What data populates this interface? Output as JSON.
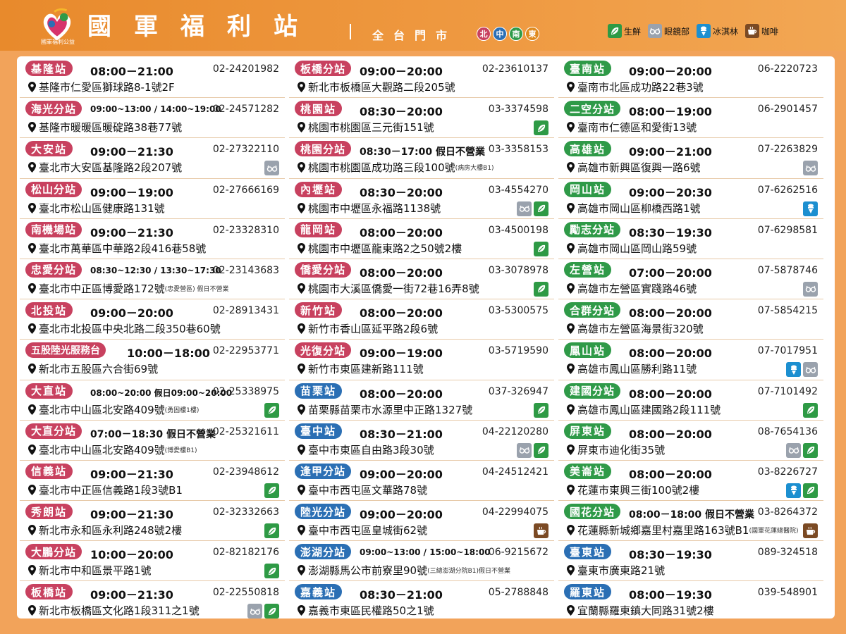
{
  "header": {
    "logo_text": "國軍福利公益",
    "title": "國軍福利站",
    "subtitle": "全台門市",
    "regions": [
      {
        "label": "北",
        "color": "#c8415f"
      },
      {
        "label": "中",
        "color": "#2b6fb4"
      },
      {
        "label": "南",
        "color": "#2f9a48"
      },
      {
        "label": "東",
        "color": "#e08a1e"
      }
    ],
    "legend": [
      {
        "icon": "fresh-produce-icon",
        "label": "生鮮"
      },
      {
        "icon": "glasses-icon",
        "label": "眼鏡部"
      },
      {
        "icon": "ice-cream-icon",
        "label": "冰淇林"
      },
      {
        "icon": "coffee-icon",
        "label": "咖啡"
      }
    ]
  },
  "columns": [
    [
      {
        "name": "基隆站",
        "hours": "08:00－21:00",
        "phone": "02-24201982",
        "address": "基隆市仁愛區獅球路8-1號2F",
        "note": "",
        "icons": []
      },
      {
        "name": "海光分站",
        "hours": "09:00~13:00 / 14:00~19:00",
        "phone": "02-24571282",
        "address": "基隆市暖暖區暖碇路38巷77號",
        "note": "",
        "icons": []
      },
      {
        "name": "大安站",
        "hours": "09:00－21:30",
        "phone": "02-27322110",
        "address": "臺北市大安區基隆路2段207號",
        "note": "",
        "icons": [
          "glasses"
        ]
      },
      {
        "name": "松山分站",
        "hours": "09:00－19:00",
        "phone": "02-27666169",
        "address": "臺北市松山區健康路131號",
        "note": "",
        "icons": []
      },
      {
        "name": "南機場站",
        "hours": "09:00－21:30",
        "phone": "02-23328310",
        "address": "臺北市萬華區中華路2段416巷58號",
        "note": "",
        "icons": []
      },
      {
        "name": "忠愛分站",
        "hours": "08:30~12:30 / 13:30~17:30",
        "phone": "02-23143683",
        "address": "臺北市中正區博愛路172號",
        "note": "(忠愛營區) 假日不營業",
        "icons": []
      },
      {
        "name": "北投站",
        "hours": "09:00－20:00",
        "phone": "02-28913431",
        "address": "臺北市北投區中央北路二段350巷60號",
        "note": "",
        "icons": []
      },
      {
        "name": "五股陸光服務台",
        "hours": "10:00－18:00",
        "phone": "02-22953771",
        "address": "新北市五股區六合街69號",
        "note": "",
        "icons": []
      },
      {
        "name": "大直站",
        "hours": "08:00~20:00 假日09:00~20:00",
        "phone": "02-25338975",
        "address": "臺北市中山區北安路409號",
        "note": "(勇固樓1樓)",
        "icons": [
          "fresh"
        ]
      },
      {
        "name": "大直分站",
        "hours": "07:00－18:30 假日不營業",
        "phone": "02-25321611",
        "address": "臺北市中山區北安路409號",
        "note": "(博愛樓B1)",
        "icons": []
      },
      {
        "name": "信義站",
        "hours": "09:00－21:30",
        "phone": "02-23948612",
        "address": "臺北市中正區信義路1段3號B1",
        "note": "",
        "icons": [
          "fresh"
        ]
      },
      {
        "name": "秀朗站",
        "hours": "09:00－21:30",
        "phone": "02-32332663",
        "address": "新北市永和區永利路248號2樓",
        "note": "",
        "icons": [
          "fresh"
        ]
      },
      {
        "name": "大鵬分站",
        "hours": "10:00－20:00",
        "phone": "02-82182176",
        "address": "新北市中和區景平路1號",
        "note": "",
        "icons": [
          "fresh"
        ]
      },
      {
        "name": "板橋站",
        "hours": "09:00－21:30",
        "phone": "02-22550818",
        "address": "新北市板橋區文化路1段311之1號",
        "note": "",
        "icons": [
          "glasses",
          "fresh"
        ]
      }
    ],
    [
      {
        "name": "板橋分站",
        "hours": "09:00－20:00",
        "phone": "02-23610137",
        "address": "新北市板橋區大觀路二段205號",
        "note": "",
        "icons": []
      },
      {
        "name": "桃園站",
        "hours": "08:30－20:00",
        "phone": "03-3374598",
        "address": "桃園市桃園區三元街151號",
        "note": "",
        "icons": [
          "fresh"
        ]
      },
      {
        "name": "桃園分站",
        "hours": "08:30－17:00 假日不營業",
        "phone": "03-3358153",
        "address": "桃園市桃園區成功路三段100號",
        "note": "(病房大樓B1)",
        "icons": []
      },
      {
        "name": "內壢站",
        "hours": "08:30－20:00",
        "phone": "03-4554270",
        "address": "桃園市中壢區永福路1138號",
        "note": "",
        "icons": [
          "glasses",
          "fresh"
        ]
      },
      {
        "name": "龍岡站",
        "hours": "08:00－20:00",
        "phone": "03-4500198",
        "address": "桃園市中壢區龍東路2之50號2樓",
        "note": "",
        "icons": [
          "fresh"
        ]
      },
      {
        "name": "僑愛分站",
        "hours": "08:00－20:00",
        "phone": "03-3078978",
        "address": "桃園市大溪區僑愛一街72巷16弄8號",
        "note": "",
        "icons": [
          "fresh"
        ]
      },
      {
        "name": "新竹站",
        "hours": "08:00－20:00",
        "phone": "03-5300575",
        "address": "新竹市香山區延平路2段6號",
        "note": "",
        "icons": []
      },
      {
        "name": "光復分站",
        "hours": "09:00－19:00",
        "phone": "03-5719590",
        "address": "新竹市東區建新路111號",
        "note": "",
        "icons": []
      },
      {
        "name": "苗栗站",
        "hours": "08:00－20:00",
        "phone": "037-326947",
        "address": "苗栗縣苗栗市水源里中正路1327號",
        "note": "",
        "icons": [
          "fresh"
        ]
      },
      {
        "name": "臺中站",
        "hours": "08:30－21:00",
        "phone": "04-22120280",
        "address": "臺中市東區自由路3段30號",
        "note": "",
        "icons": [
          "glasses",
          "fresh"
        ]
      },
      {
        "name": "逢甲分站",
        "hours": "09:00－20:00",
        "phone": "04-24512421",
        "address": "臺中市西屯區文華路78號",
        "note": "",
        "icons": []
      },
      {
        "name": "陸光分站",
        "hours": "09:00－20:00",
        "phone": "04-22994075",
        "address": "臺中市西屯區皇城街62號",
        "note": "",
        "icons": [
          "coffee"
        ]
      },
      {
        "name": "澎湖分站",
        "hours": "09:00~13:00 / 15:00~18:00",
        "phone": "06-9215672",
        "address": "澎湖縣馬公市前寮里90號",
        "note": "(三總澎湖分院B1)假日不營業",
        "icons": []
      },
      {
        "name": "嘉義站",
        "hours": "08:30－21:00",
        "phone": "05-2788848",
        "address": "嘉義市東區民權路50之1號",
        "note": "",
        "icons": []
      }
    ],
    [
      {
        "name": "臺南站",
        "hours": "09:00－20:00",
        "phone": "06-2220723",
        "address": "臺南市北區成功路22巷3號",
        "note": "",
        "icons": []
      },
      {
        "name": "二空分站",
        "hours": "08:00－19:00",
        "phone": "06-2901457",
        "address": "臺南市仁德區和愛街13號",
        "note": "",
        "icons": []
      },
      {
        "name": "高雄站",
        "hours": "09:00－21:00",
        "phone": "07-2263829",
        "address": "高雄市新興區復興一路6號",
        "note": "",
        "icons": [
          "glasses"
        ]
      },
      {
        "name": "岡山站",
        "hours": "09:00－20:30",
        "phone": "07-6262516",
        "address": "高雄市岡山區柳橋西路1號",
        "note": "",
        "icons": [
          "ice"
        ]
      },
      {
        "name": "勵志分站",
        "hours": "08:30－19:30",
        "phone": "07-6298581",
        "address": "高雄市岡山區岡山路59號",
        "note": "",
        "icons": []
      },
      {
        "name": "左營站",
        "hours": "07:00－20:00",
        "phone": "07-5878746",
        "address": "高雄市左營區實踐路46號",
        "note": "",
        "icons": [
          "glasses"
        ]
      },
      {
        "name": "合群分站",
        "hours": "08:00－20:00",
        "phone": "07-5854215",
        "address": "高雄市左營區海景街320號",
        "note": "",
        "icons": []
      },
      {
        "name": "鳳山站",
        "hours": "08:00－20:00",
        "phone": "07-7017951",
        "address": "高雄市鳳山區勝利路11號",
        "note": "",
        "icons": [
          "ice",
          "glasses"
        ]
      },
      {
        "name": "建國分站",
        "hours": "08:00－20:00",
        "phone": "07-7101492",
        "address": "高雄市鳳山區建國路2段111號",
        "note": "",
        "icons": [
          "fresh"
        ]
      },
      {
        "name": "屏東站",
        "hours": "08:00－20:00",
        "phone": "08-7654136",
        "address": "屏東市迪化街35號",
        "note": "",
        "icons": [
          "glasses",
          "fresh"
        ]
      },
      {
        "name": "美崙站",
        "hours": "08:00－20:00",
        "phone": "03-8226727",
        "address": "花蓮市東興三街100號2樓",
        "note": "",
        "icons": [
          "ice",
          "fresh"
        ]
      },
      {
        "name": "國花分站",
        "hours": "08:00－18:00 假日不營業",
        "phone": "03-8264372",
        "address": "花蓮縣新城鄉嘉里村嘉里路163號B1",
        "note": "(國軍花蓮總醫院)",
        "icons": [
          "coffee"
        ]
      },
      {
        "name": "臺東站",
        "hours": "08:30－19:30",
        "phone": "089-324518",
        "address": "臺東市廣東路21號",
        "note": "",
        "icons": []
      },
      {
        "name": "羅東站",
        "hours": "08:00－19:30",
        "phone": "039-548901",
        "address": "宜蘭縣羅東鎮大同路31號2樓",
        "note": "",
        "icons": []
      }
    ]
  ],
  "column_regions": [
    [
      "north",
      "north",
      "north",
      "north",
      "north",
      "north",
      "north",
      "north",
      "north",
      "north",
      "north",
      "north",
      "north",
      "north"
    ],
    [
      "north",
      "north",
      "north",
      "north",
      "north",
      "north",
      "north",
      "north",
      "central",
      "central",
      "central",
      "central",
      "central",
      "central"
    ],
    [
      "south",
      "south",
      "south",
      "south",
      "south",
      "south",
      "south",
      "south",
      "south",
      "south",
      "south",
      "south",
      "east",
      "east"
    ]
  ]
}
